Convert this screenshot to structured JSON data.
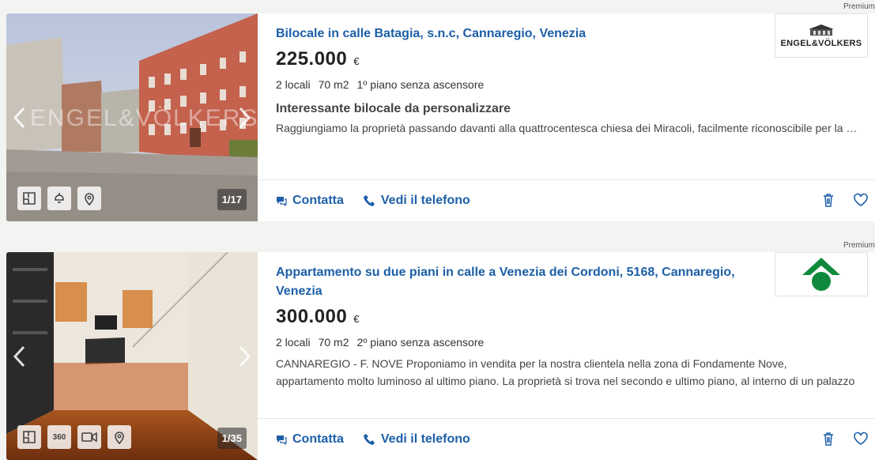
{
  "listings": [
    {
      "premium_label": "Premium",
      "title": "Bilocale in calle Batagia, s.n.c, Cannaregio, Venezia",
      "price": "225.000",
      "currency": "€",
      "features": [
        "2 locali",
        "70 m2",
        "1º piano senza ascensore"
      ],
      "subtitle": "Interessante bilocale da personalizzare",
      "description_lines": [
        "Raggiungiamo la proprietà passando davanti alla quattrocentesca chiesa dei Miracoli, facilmente riconoscibile per la sua bellezza"
      ],
      "photo_counter": "1/17",
      "photo_watermark": "ENGEL&VÖLKERS",
      "photo_tools": [
        "floorplan-icon",
        "lamp-icon",
        "map-pin-icon"
      ],
      "logo_text": "ENGEL&VÖLKERS",
      "contact_label": "Contatta",
      "phone_label": "Vedi il telefono"
    },
    {
      "premium_label": "Premium",
      "title": "Appartamento su due piani in calle a Venezia dei Cordoni, 5168, Cannaregio, Venezia",
      "price": "300.000",
      "currency": "€",
      "features": [
        "2 locali",
        "70 m2",
        "2º piano senza ascensore"
      ],
      "subtitle": "",
      "description_lines": [
        "CANNAREGIO - F. NOVE Proponiamo in vendita per la nostra clientela nella zona di Fondamente Nove,",
        "appartamento molto luminoso al ultimo piano. La proprietà si trova nel secondo e ultimo piano, al interno di un palazzo"
      ],
      "photo_counter": "1/35",
      "photo_tools": [
        "floorplan-icon",
        "360",
        "video-icon",
        "map-pin-icon"
      ],
      "logo_text": "",
      "contact_label": "Contatta",
      "phone_label": "Vedi il telefono"
    }
  ],
  "colors": {
    "link_blue": "#1d5fa8",
    "logo_green": "#0f8a3c",
    "page_bg": "#f3f3f1"
  }
}
